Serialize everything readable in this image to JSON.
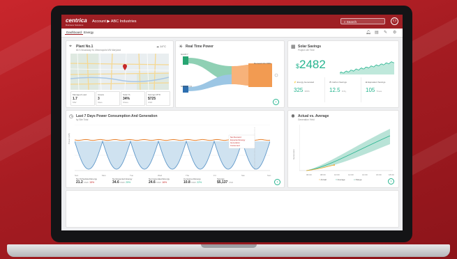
{
  "app": {
    "logo": "centrica",
    "logo_sub": "Business Solutions",
    "breadcrumb": "Account  ▶  ABC Industries",
    "search_placeholder": "Search",
    "avatar": "⚇"
  },
  "tabs": [
    {
      "label": "Dashboard",
      "active": true
    },
    {
      "label": "Energy",
      "active": false
    }
  ],
  "toolbar_icons": [
    "bell-icon",
    "document-icon",
    "wrench-icon",
    "gear-icon"
  ],
  "plant": {
    "title": "Plant No.1",
    "address": "84 S Broadway St, Minneapolis MN Maryland",
    "weather": "14°C",
    "stats": [
      {
        "label": "Managed Load",
        "value": "1.7",
        "unit": "MW"
      },
      {
        "label": "Assets",
        "value": "3",
        "unit": "Sites"
      },
      {
        "label": "Solar %",
        "value": "34%",
        "unit": "Share"
      },
      {
        "label": "Savings MTD",
        "value": "$725",
        "unit": "USD"
      }
    ]
  },
  "realtime": {
    "title": "Real Time Power",
    "labels": {
      "grid": "Grid 8.7",
      "demand": "Demand 16.4 MW",
      "storage": "Storage 7.8"
    }
  },
  "solar": {
    "title": "Solar Savings",
    "subtitle": "Project Life Time",
    "amount": "2482",
    "currency": "$",
    "boxes": [
      {
        "label": "Energy Generated",
        "value": "325",
        "unit": "MWh"
      },
      {
        "label": "Carbon Savings",
        "value": "12.5",
        "unit": "tCO₂"
      },
      {
        "label": "Equivalent Savings",
        "value": "105",
        "unit": "Trees"
      }
    ]
  },
  "last7": {
    "title": "Last 7 Days Power Consumption And Generation",
    "subtitle": "by Site Total",
    "xticks": [
      "Sun",
      "Mon",
      "Tue",
      "Wed",
      "Thu",
      "Fri",
      "Sat",
      "Sun"
    ],
    "ylabel": "Power (kW)",
    "tooltip": [
      "Net Demand",
      "Expected Energy",
      "Generation",
      "Consumed"
    ],
    "legend": [
      {
        "label": "Net Scheduled Energy",
        "value": "21.2",
        "unit": "MWh",
        "pct": "15%",
        "up": false
      },
      {
        "label": "Net Expected Energy",
        "value": "34.6",
        "unit": "MWh",
        "pct": "25%",
        "up": true
      },
      {
        "label": "Net Generated Energy",
        "value": "24.6",
        "unit": "MWh",
        "pct": "16%",
        "up": false
      },
      {
        "label": "Consumed Energy",
        "value": "10.8",
        "unit": "MWh",
        "pct": "22%",
        "up": true
      },
      {
        "label": "Savings",
        "value": "$5,137",
        "unit": "USD",
        "pct": "",
        "up": true
      }
    ],
    "colors": {
      "demand": "#e8822e",
      "generation": "#7aaed6",
      "fill": "#cfe2f0"
    }
  },
  "actual": {
    "title": "Actual vs. Average",
    "subtitle": "Generation Yield",
    "ylabel": "Generation",
    "xticks": [
      "06:00",
      "08:00",
      "10:00",
      "12:00",
      "14:00",
      "16:00",
      "18:00"
    ],
    "legend": [
      "Actual",
      "Average",
      "Range"
    ],
    "colors": {
      "band": "#a7dccd",
      "line": "#26b48f"
    }
  },
  "footer_card": {
    "title": ""
  }
}
